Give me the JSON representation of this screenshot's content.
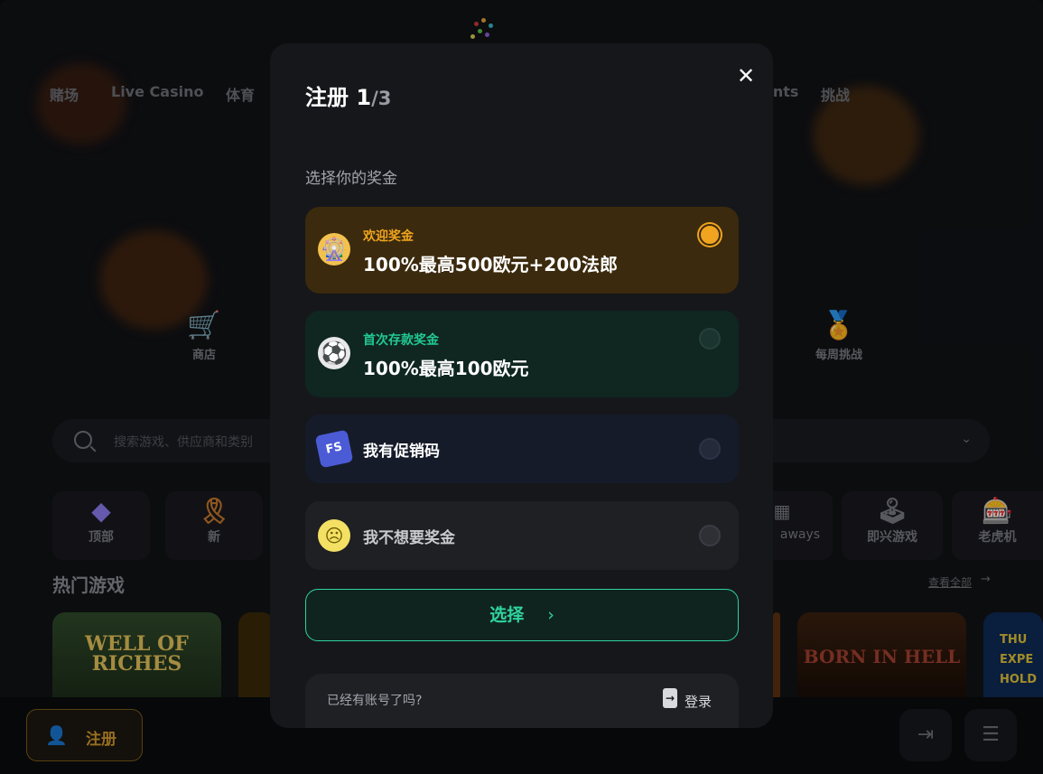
{
  "nav": {
    "items": [
      "赌场",
      "Live Casino",
      "体育",
      "ents",
      "挑战"
    ]
  },
  "features": [
    {
      "label": "商店",
      "icon": "shop-cart-icon"
    },
    {
      "label": "每周挑战",
      "icon": "medal-icon"
    }
  ],
  "search": {
    "placeholder": "搜索游戏、供应商和类别"
  },
  "categories": [
    {
      "label": "顶部",
      "icon": "diamond-icon"
    },
    {
      "label": "新",
      "icon": "ribbon-icon"
    },
    {
      "label": "aways",
      "icon": "slot-grid-icon"
    },
    {
      "label": "即兴游戏",
      "icon": "joystick-icon"
    },
    {
      "label": "老虎机",
      "icon": "slot-machine-icon"
    }
  ],
  "hot_games": {
    "title": "热门游戏",
    "see_all": "查看全部",
    "games": [
      {
        "name": "WELL OF RICHES"
      },
      {
        "name": "BORN IN HELL"
      },
      {
        "name": "THU EXPE HOLD"
      }
    ]
  },
  "bottom": {
    "register_label": "注册"
  },
  "modal": {
    "title": "注册",
    "step_current": "1",
    "step_total": "/3",
    "subtitle": "选择你的奖金",
    "options": [
      {
        "tag": "欢迎奖金",
        "text": "100%最高500欧元+200法郎",
        "icon": "wheel-icon",
        "selected": true
      },
      {
        "tag": "首次存款奖金",
        "text": "100%最高100欧元",
        "icon": "soccer-ball-icon",
        "selected": false
      },
      {
        "tag": "",
        "text": "我有促销码",
        "icon": "ticket-icon",
        "selected": false
      },
      {
        "tag": "",
        "text": "我不想要奖金",
        "icon": "sad-face-icon",
        "selected": false
      }
    ],
    "select_label": "选择",
    "login_question": "已经有账号了吗?",
    "login_label": "登录"
  },
  "colors": {
    "accent_gold": "#f0a41f",
    "accent_green": "#2fd39d",
    "modal_bg": "#16171b"
  }
}
